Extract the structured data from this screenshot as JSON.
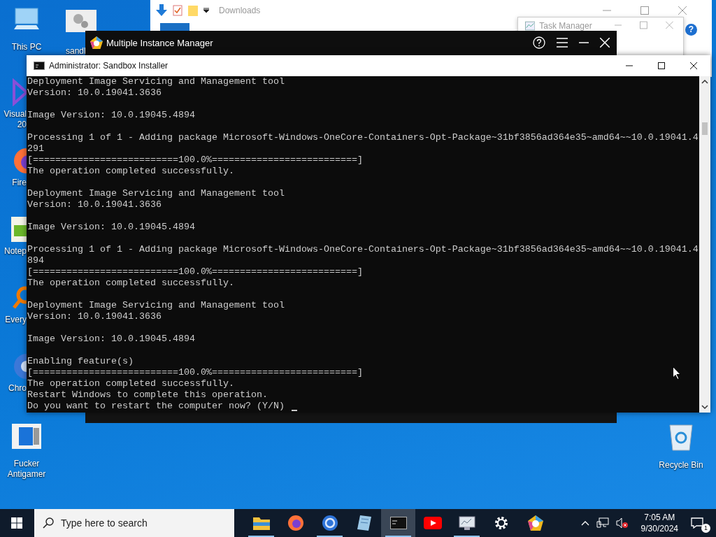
{
  "desktop": {
    "top_icons": [
      {
        "kind": "computer",
        "label": "This PC"
      },
      {
        "kind": "gears",
        "label": "sandl"
      }
    ],
    "left_partial_icons": [
      {
        "kind": "ide",
        "label": "Visual 20"
      },
      {
        "kind": "firefox",
        "label": "Fire"
      },
      {
        "kind": "notepad",
        "label": "Notep"
      },
      {
        "kind": "search",
        "label": "Every"
      },
      {
        "kind": "chrome",
        "label": "Chro"
      }
    ],
    "left_icons": [
      {
        "kind": "app",
        "label": "Fucker Antigamer"
      }
    ],
    "right_icons": [
      {
        "kind": "recycle",
        "label": "Recycle Bin"
      }
    ]
  },
  "explorer": {
    "title": "Downloads",
    "help_glyph": "?"
  },
  "task_manager": {
    "title": "Task Manager"
  },
  "instance_manager": {
    "title": "Multiple Instance Manager"
  },
  "console": {
    "title": "Administrator:  Sandbox Installer",
    "paragraphs": [
      [
        "Deployment Image Servicing and Management tool",
        "Version: 10.0.19041.3636"
      ],
      [
        "Image Version: 10.0.19045.4894"
      ],
      [
        "Processing 1 of 1 - Adding package Microsoft-Windows-OneCore-Containers-Opt-Package~31bf3856ad364e35~amd64~~10.0.19041.4",
        "291",
        "[==========================100.0%==========================]",
        "The operation completed successfully."
      ],
      [
        "Deployment Image Servicing and Management tool",
        "Version: 10.0.19041.3636"
      ],
      [
        "Image Version: 10.0.19045.4894"
      ],
      [
        "Processing 1 of 1 - Adding package Microsoft-Windows-OneCore-Containers-Opt-Package~31bf3856ad364e35~amd64~~10.0.19041.4",
        "894",
        "[==========================100.0%==========================]",
        "The operation completed successfully."
      ],
      [
        "Deployment Image Servicing and Management tool",
        "Version: 10.0.19041.3636"
      ],
      [
        "Image Version: 10.0.19045.4894"
      ],
      [
        "Enabling feature(s)",
        "[==========================100.0%==========================]",
        "The operation completed successfully.",
        "Restart Windows to complete this operation.",
        "Do you want to restart the computer now? (Y/N)"
      ]
    ]
  },
  "taskbar": {
    "search": {
      "placeholder": "Type here to search"
    },
    "apps": [
      {
        "kind": "folder",
        "running": true,
        "selected": false
      },
      {
        "kind": "firefox",
        "running": false,
        "selected": false
      },
      {
        "kind": "chrome",
        "running": true,
        "selected": false
      },
      {
        "kind": "notepad",
        "running": false,
        "selected": false
      },
      {
        "kind": "terminal",
        "running": true,
        "selected": true
      },
      {
        "kind": "video",
        "running": false,
        "selected": false
      },
      {
        "kind": "monitor",
        "running": true,
        "selected": false
      },
      {
        "kind": "settings",
        "running": false,
        "selected": false
      },
      {
        "kind": "pentagon",
        "running": false,
        "selected": false
      }
    ],
    "time": "7:05 AM",
    "date": "9/30/2024",
    "notification_count": "1"
  }
}
